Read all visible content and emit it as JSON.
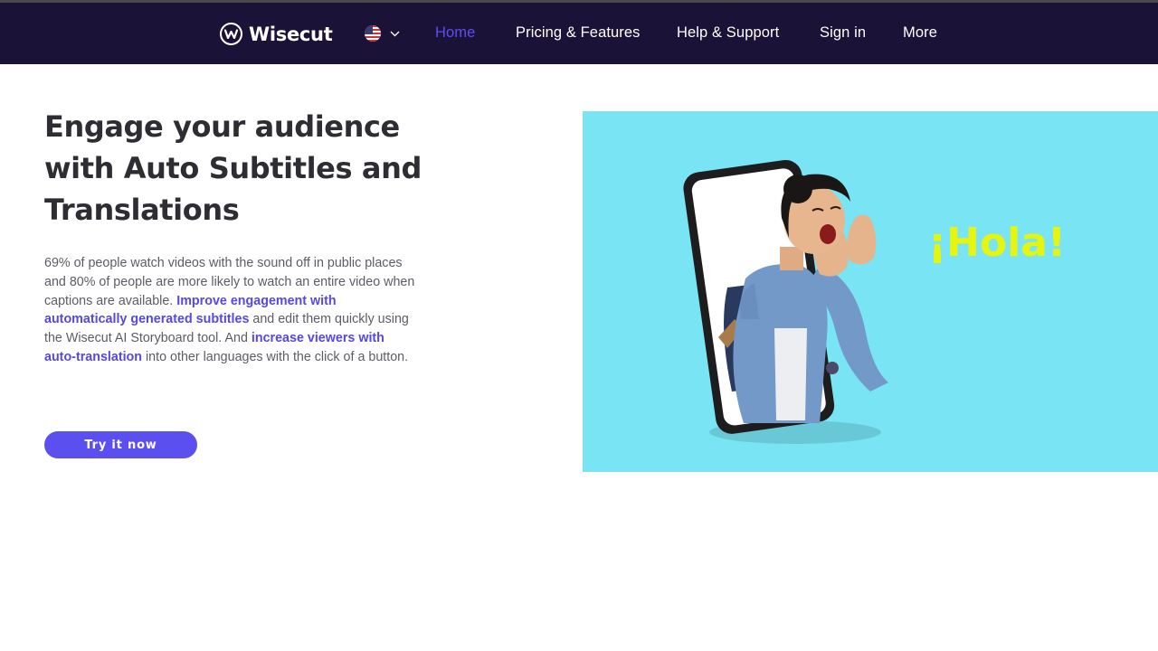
{
  "nav": {
    "brand": "Wisecut",
    "language_icon": "us-flag-icon",
    "links": [
      {
        "label": "Home",
        "active": true
      },
      {
        "label": "Pricing & Features",
        "active": false
      },
      {
        "label": "Help & Support",
        "active": false
      },
      {
        "label": "Sign in",
        "active": false
      },
      {
        "label": "More",
        "active": false
      }
    ]
  },
  "hero": {
    "title": "Engage your audience with Auto Subtitles and Translations",
    "desc_1": "69% of people watch videos with the sound off in public places and 80% of people are more likely to watch an entire video when captions are available. ",
    "desc_hl_1": "Improve engagement with automatically generated subtitles",
    "desc_2": " and edit them quickly using the Wisecut AI Storyboard tool. And ",
    "desc_hl_2": "increase viewers with auto-translation",
    "desc_3": " into other languages with the click of a button.",
    "cta": "Try it now",
    "image_text": "¡Hola!"
  },
  "colors": {
    "nav_bg": "#1b1238",
    "accent": "#5b4ff0",
    "image_bg": "#78e4f4",
    "hola": "#e5f50e"
  }
}
